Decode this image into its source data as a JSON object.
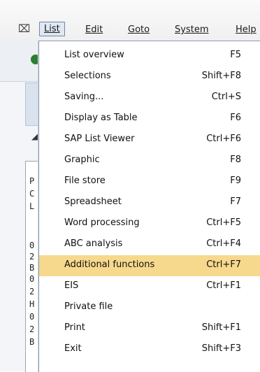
{
  "menubar": {
    "icon": "menu-icon",
    "items": [
      {
        "label": "List",
        "active": true
      },
      {
        "label": "Edit"
      },
      {
        "label": "Goto"
      },
      {
        "label": "System"
      },
      {
        "label": "Help"
      }
    ]
  },
  "background": {
    "chars": [
      "P",
      "C",
      "L",
      "0",
      "2",
      "B",
      "0",
      "2",
      "H",
      "0",
      "2",
      "B"
    ]
  },
  "menu": {
    "items": [
      {
        "label": "List overview",
        "shortcut": "F5"
      },
      {
        "label": "Selections",
        "shortcut": "Shift+F8"
      },
      {
        "label": "Saving...",
        "shortcut": "Ctrl+S"
      },
      {
        "label": "Display as Table",
        "shortcut": "F6"
      },
      {
        "label": "SAP List Viewer",
        "shortcut": "Ctrl+F6"
      },
      {
        "label": "Graphic",
        "shortcut": "F8"
      },
      {
        "label": "File store",
        "shortcut": "F9"
      },
      {
        "label": "Spreadsheet",
        "shortcut": "F7"
      },
      {
        "label": "Word processing",
        "shortcut": "Ctrl+F5"
      },
      {
        "label": "ABC analysis",
        "shortcut": "Ctrl+F4"
      },
      {
        "label": "Additional functions",
        "shortcut": "Ctrl+F7",
        "highlighted": true
      },
      {
        "label": "EIS",
        "shortcut": "Ctrl+F1"
      },
      {
        "label": "Private file",
        "shortcut": ""
      },
      {
        "label": "Print",
        "shortcut": "Shift+F1"
      },
      {
        "label": "Exit",
        "shortcut": "Shift+F3"
      }
    ],
    "highlight_color": "#f7d98d"
  }
}
